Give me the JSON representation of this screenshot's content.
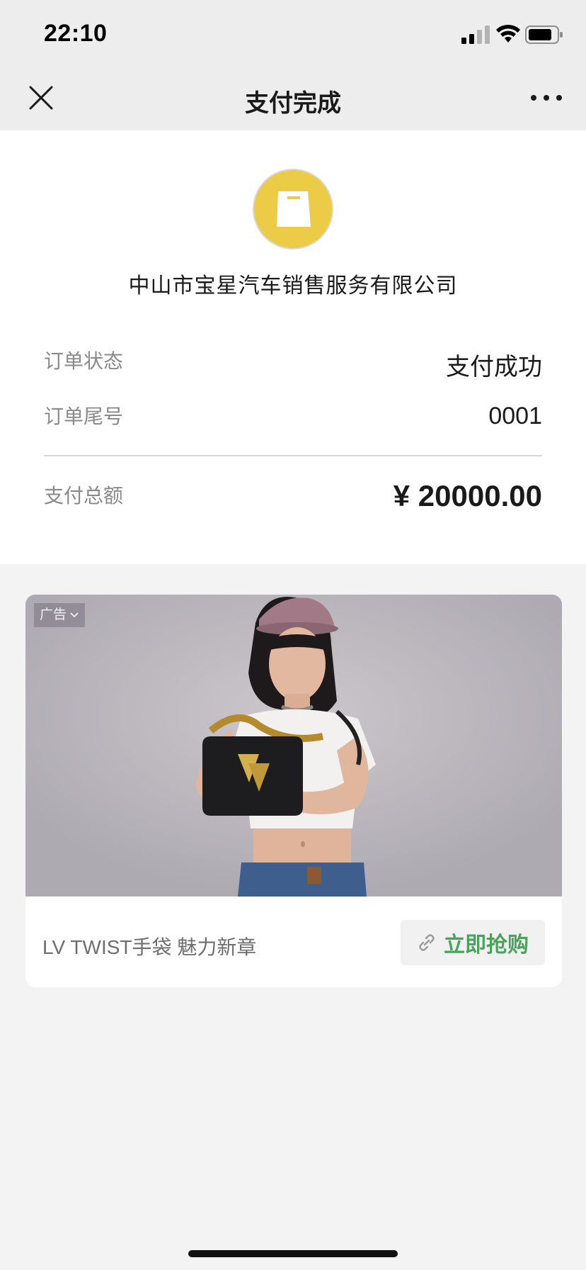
{
  "status_bar": {
    "time": "22:10"
  },
  "nav": {
    "title": "支付完成"
  },
  "merchant": {
    "name": "中山市宝星汽车销售服务有限公司",
    "logo_color": "#eccb47"
  },
  "order": {
    "status_label": "订单状态",
    "status_value": "支付成功",
    "tail_label": "订单尾号",
    "tail_value": "0001",
    "total_label": "支付总额",
    "total_value": "¥ 20000.00"
  },
  "ad": {
    "badge": "广告",
    "caption": "LV TWIST手袋 魅力新章",
    "button_label": "立即抢购",
    "accent_color": "#4aa35b"
  }
}
